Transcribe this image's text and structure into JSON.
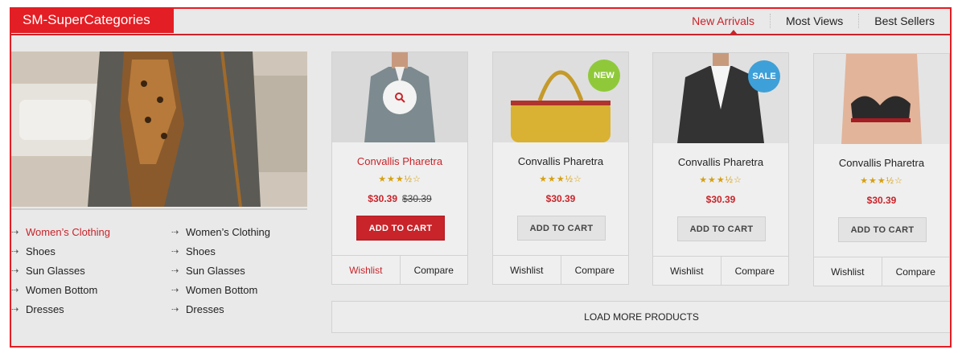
{
  "header": {
    "title": "SM-SuperCategories",
    "tabs": [
      {
        "label": "New Arrivals",
        "active": true
      },
      {
        "label": "Most Views",
        "active": false
      },
      {
        "label": "Best Sellers",
        "active": false
      }
    ]
  },
  "categories": {
    "column1": [
      "Women’s Clothing",
      "Shoes",
      "Sun Glasses",
      "Women Bottom",
      "Dresses"
    ],
    "column2": [
      "Women’s Clothing",
      "Shoes",
      "Sun Glasses",
      "Women Bottom",
      "Dresses"
    ],
    "active_item": "Women’s Clothing"
  },
  "products": [
    {
      "name": "Convallis Pharetra",
      "rating": 3.5,
      "stars": "★★★½☆",
      "price": "$30.39",
      "old_price": "$30.39",
      "button": "ADD TO CART",
      "wishlist": "Wishlist",
      "compare": "Compare",
      "badge": ""
    },
    {
      "name": "Convallis Pharetra",
      "rating": 3.5,
      "stars": "★★★½☆",
      "price": "$30.39",
      "old_price": "",
      "button": "ADD TO CART",
      "wishlist": "Wishlist",
      "compare": "Compare",
      "badge": "NEW"
    },
    {
      "name": "Convallis Pharetra",
      "rating": 3.5,
      "stars": "★★★½☆",
      "price": "$30.39",
      "old_price": "",
      "button": "ADD TO CART",
      "wishlist": "Wishlist",
      "compare": "Compare",
      "badge": "SALE"
    },
    {
      "name": "Convallis Pharetra",
      "rating": 3.5,
      "stars": "★★★½☆",
      "price": "$30.39",
      "old_price": "",
      "button": "ADD TO CART",
      "wishlist": "Wishlist",
      "compare": "Compare",
      "badge": ""
    }
  ],
  "load_more": "LOAD MORE PRODUCTS",
  "icons": {
    "zoom": "search-icon",
    "category_arrow": "dotted-arrow-icon"
  },
  "colors": {
    "accent": "#c8242a",
    "brand_red": "#e31e24",
    "new_badge": "#8fc93a",
    "sale_badge": "#3ea0d8",
    "star": "#d6a012"
  }
}
